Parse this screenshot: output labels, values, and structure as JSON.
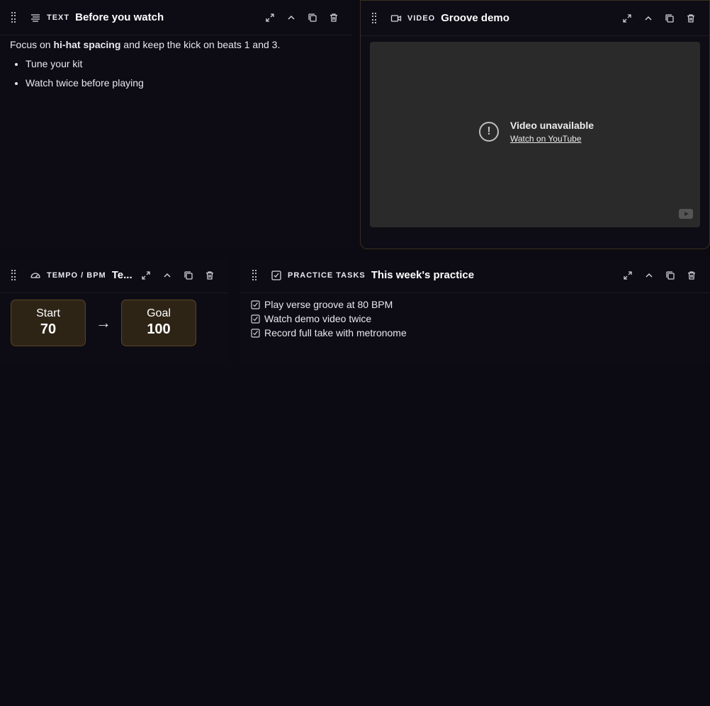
{
  "text_widget": {
    "kind_label": "TEXT",
    "title": "Before you watch",
    "intro_before": "Focus on ",
    "intro_bold": "hi-hat spacing",
    "intro_after": " and keep the kick on beats 1 and 3.",
    "bullets": [
      "Tune your kit",
      "Watch twice before playing"
    ]
  },
  "video_widget": {
    "kind_label": "VIDEO",
    "title": "Groove demo",
    "unavailable_text": "Video unavailable",
    "watch_link": "Watch on YouTube"
  },
  "tempo_widget": {
    "kind_label": "TEMPO / BPM",
    "title": "Te...",
    "start_label": "Start",
    "start_value": "70",
    "arrow": "→",
    "goal_label": "Goal",
    "goal_value": "100"
  },
  "tasks_widget": {
    "kind_label": "PRACTICE TASKS",
    "title": "This week's practice",
    "tasks": [
      "Play verse groove at 80 BPM",
      "Watch demo video twice",
      "Record full take with metronome"
    ]
  },
  "icons": {
    "drag": "drag-handle-icon",
    "expand": "expand-icon",
    "collapse": "chevron-up-icon",
    "duplicate": "duplicate-icon",
    "delete": "trash-icon"
  },
  "colors": {
    "background": "#0c0b13",
    "accent_border": "#5a4423",
    "accent_fill": "#2e2416"
  }
}
